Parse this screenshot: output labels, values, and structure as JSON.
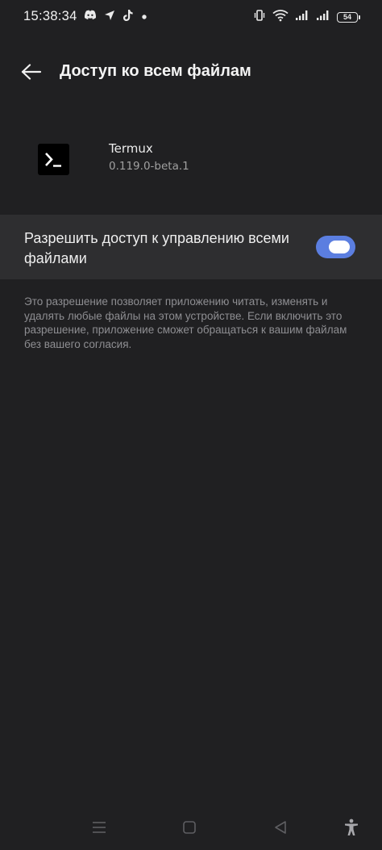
{
  "status_bar": {
    "time": "15:38:34",
    "battery": "54",
    "left_icons": [
      "discord-icon",
      "location-arrow-icon",
      "tiktok-icon",
      "dot-icon"
    ],
    "right_icons": [
      "vibrate-icon",
      "wifi-icon",
      "signal-icon",
      "signal-icon",
      "battery-icon"
    ]
  },
  "app_bar": {
    "title": "Доступ ко всем файлам"
  },
  "app": {
    "name": "Termux",
    "version": "0.119.0-beta.1"
  },
  "setting": {
    "label": "Разрешить доступ к управлению всеми файлами",
    "enabled": true
  },
  "description": "Это разрешение позволяет приложению читать, изменять и удалять любые файлы на этом устройстве. Если включить это разрешение, приложение сможет обращаться к вашим файлам без вашего согласия.",
  "colors": {
    "background": "#202022",
    "row_background": "#2e2e30",
    "accent": "#5b7ee0"
  },
  "nav_bar": {
    "items": [
      "menu-icon",
      "home-icon",
      "back-icon",
      "accessibility-icon"
    ]
  }
}
